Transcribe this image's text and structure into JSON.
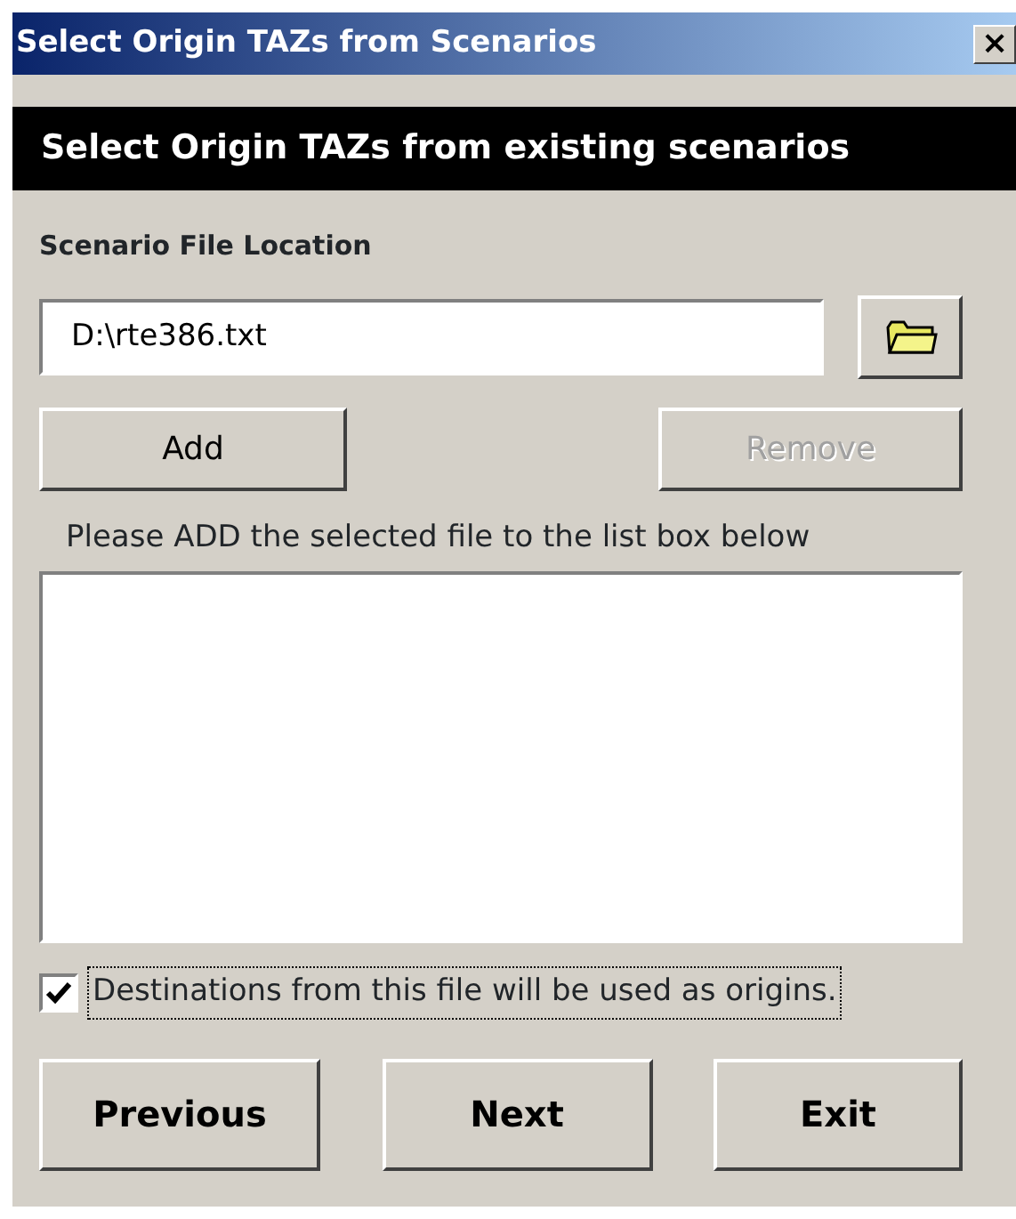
{
  "window": {
    "title": "Select Origin TAZs from Scenarios",
    "close": "×"
  },
  "banner": "Select Origin TAZs from existing scenarios",
  "file_section": {
    "label": "Scenario File Location",
    "value": "D:\\rte386.txt"
  },
  "buttons_top": [
    {
      "label": "Add",
      "disabled": false
    },
    {
      "label": "Remove",
      "disabled": true
    }
  ],
  "instruction": "Please ADD the selected file to the list box below",
  "checkbox": {
    "label": "Destinations from this file will be used as origins.",
    "checked": true,
    "focused": true
  },
  "buttons_bottom": [
    {
      "label": "Previous"
    },
    {
      "label": "Next"
    },
    {
      "label": "Exit"
    }
  ]
}
